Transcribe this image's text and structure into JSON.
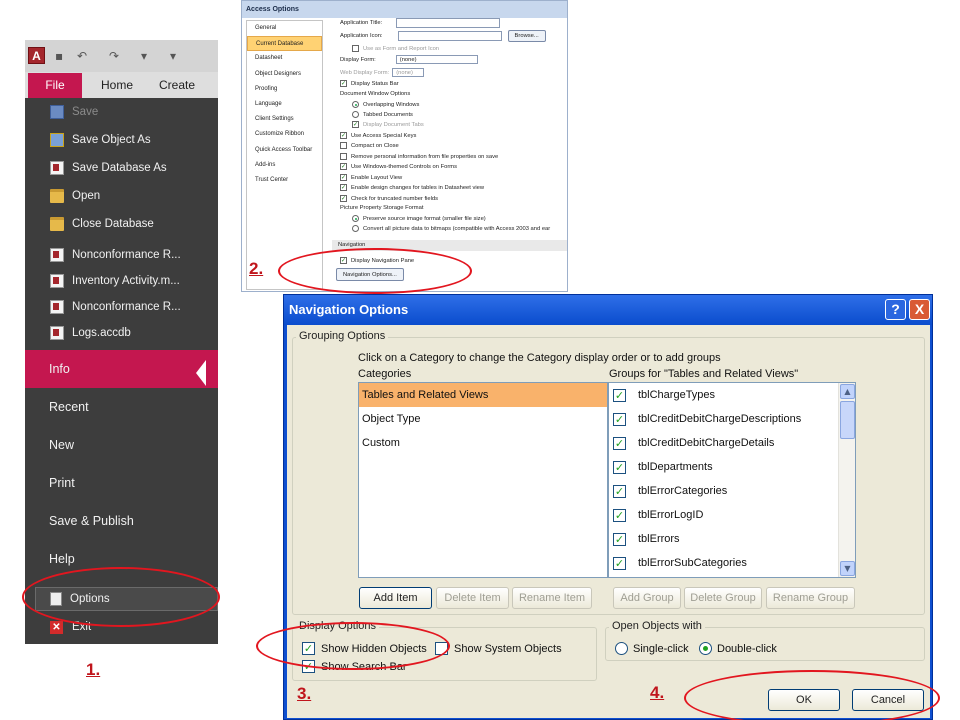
{
  "backstage": {
    "tabs": {
      "file": "File",
      "home": "Home",
      "create": "Create"
    },
    "items": [
      {
        "label": "Save",
        "icon": "save-icon",
        "disabled": true
      },
      {
        "label": "Save Object As",
        "icon": "save-object-icon"
      },
      {
        "label": "Save Database As",
        "icon": "access-db-icon"
      },
      {
        "label": "Open",
        "icon": "open-folder-icon"
      },
      {
        "label": "Close Database",
        "icon": "folder-icon"
      }
    ],
    "recent": [
      "Nonconformance R...",
      "Inventory Activity.m...",
      "Nonconformance R...",
      "Logs.accdb"
    ],
    "sections": [
      "Info",
      "Recent",
      "New",
      "Print",
      "Save & Publish",
      "Help"
    ],
    "selected_section": "Info",
    "options": "Options",
    "exit": "Exit"
  },
  "access_options": {
    "title": "Access Options",
    "nav": [
      "General",
      "Current Database",
      "Datasheet",
      "Object Designers",
      "Proofing",
      "Language",
      "Client Settings",
      "Customize Ribbon",
      "Quick Access Toolbar",
      "Add-ins",
      "Trust Center"
    ],
    "selected_nav": "Current Database",
    "application_title": "Application Title:",
    "application_icon": "Application Icon:",
    "browse": "Browse...",
    "use_as_icon": "Use as Form and Report Icon",
    "display_form": "Display Form:",
    "display_form_value": "(none)",
    "web_display_form": "Web Display Form:",
    "web_display_form_value": "(none)",
    "display_status_bar": "Display Status Bar",
    "doc_window_options": "Document Window Options",
    "overlapping": "Overlapping Windows",
    "tabbed": "Tabbed Documents",
    "display_doc_tabs": "Display Document Tabs",
    "special_keys": "Use Access Special Keys",
    "compact_on_close": "Compact on Close",
    "remove_personal": "Remove personal information from file properties on save",
    "windows_themed": "Use Windows-themed Controls on Forms",
    "layout_view": "Enable Layout View",
    "design_changes": "Enable design changes for tables in Datasheet view",
    "truncated": "Check for truncated number fields",
    "picture_storage": "Picture Property Storage Format",
    "preserve_source": "Preserve source image format (smaller file size)",
    "convert_all": "Convert all picture data to bitmaps (compatible with Access 2003 and ear",
    "navigation": "Navigation",
    "display_nav_pane": "Display Navigation Pane",
    "nav_options_button": "Navigation Options..."
  },
  "nav_dialog": {
    "title": "Navigation Options",
    "help": "?",
    "close": "X",
    "grouping_options": "Grouping Options",
    "instruction": "Click on a Category to change the Category display order or to add groups",
    "categories_label": "Categories",
    "groups_label": "Groups for \"Tables and Related Views\"",
    "categories": [
      "Tables and Related Views",
      "Object Type",
      "Custom"
    ],
    "selected_category": "Tables and Related Views",
    "groups": [
      {
        "name": "tblChargeTypes",
        "checked": true
      },
      {
        "name": "tblCreditDebitChargeDescriptions",
        "checked": true
      },
      {
        "name": "tblCreditDebitChargeDetails",
        "checked": true
      },
      {
        "name": "tblDepartments",
        "checked": true
      },
      {
        "name": "tblErrorCategories",
        "checked": true
      },
      {
        "name": "tblErrorLogID",
        "checked": true
      },
      {
        "name": "tblErrors",
        "checked": true
      },
      {
        "name": "tblErrorSubCategories",
        "checked": true
      }
    ],
    "add_item": "Add Item",
    "delete_item": "Delete Item",
    "rename_item": "Rename Item",
    "add_group": "Add Group",
    "delete_group": "Delete Group",
    "rename_group": "Rename Group",
    "display_options": "Display Options",
    "show_hidden": "Show Hidden Objects",
    "show_system": "Show System Objects",
    "show_search": "Show Search Bar",
    "open_objects_with": "Open Objects with",
    "single_click": "Single-click",
    "double_click": "Double-click",
    "ok": "OK",
    "cancel": "Cancel"
  },
  "annotations": {
    "step1": "1.",
    "step2": "2.",
    "step3": "3.",
    "step4": "4.",
    "color": "#e2161f"
  }
}
